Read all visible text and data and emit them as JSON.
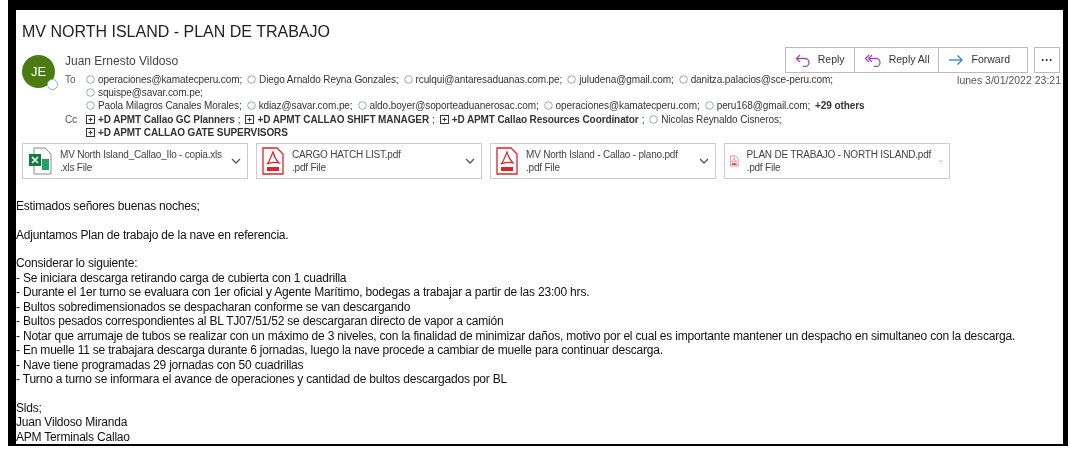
{
  "subject": "MV NORTH ISLAND - PLAN DE TRABAJO",
  "actions": [
    {
      "kind": "reply",
      "label": "Reply"
    },
    {
      "kind": "reply_all",
      "label": "Reply All"
    },
    {
      "kind": "forward",
      "label": "Forward"
    },
    {
      "kind": "more",
      "label": "···"
    }
  ],
  "sender": {
    "initials": "JE",
    "name": "Juan Ernesto Vildoso"
  },
  "date": "lunes 3/01/2022 23:21",
  "to": {
    "label": "To",
    "recipients": [
      {
        "kind": "person",
        "text": "operaciones@kamatecperu.com;"
      },
      {
        "kind": "person",
        "text": "Diego Arnaldo Reyna Gonzales;"
      },
      {
        "kind": "person",
        "text": "rculqui@antaresaduanas.com.pe;"
      },
      {
        "kind": "person",
        "text": "juludena@gmail.com;"
      },
      {
        "kind": "person",
        "text": "danitza.palacios@sce-peru.com;"
      },
      {
        "kind": "person",
        "text": "squispe@savar.com.pe;"
      },
      {
        "kind": "break"
      },
      {
        "kind": "person",
        "text": "Paola Milagros Canales Morales;"
      },
      {
        "kind": "person",
        "text": "kdiaz@savar.com.pe;"
      },
      {
        "kind": "person",
        "text": "aldo.boyer@soporteaduanerosac.com;"
      },
      {
        "kind": "person",
        "text": "operaciones@kamatecperu.com;"
      },
      {
        "kind": "person",
        "text": "peru168@gmail.com;"
      },
      {
        "kind": "more",
        "text": "+29 others"
      }
    ]
  },
  "cc": {
    "label": "Cc",
    "recipients": [
      {
        "kind": "group",
        "text": "+D APMT Callao GC Planners",
        "sep": ";"
      },
      {
        "kind": "group",
        "text": "+D APMT CALLAO SHIFT MANAGER",
        "sep": ";"
      },
      {
        "kind": "group",
        "text": "+D APMT Callao Resources Coordinator",
        "sep": ";"
      },
      {
        "kind": "person",
        "text": "Nicolas Reynaldo Cisneros;"
      },
      {
        "kind": "group",
        "text": "+D APMT CALLAO GATE SUPERVISORS"
      }
    ]
  },
  "attachments": [
    {
      "kind": "xls",
      "name": "MV North Island_Callao_Ilo - copia.xls",
      "type": ".xls File"
    },
    {
      "kind": "pdf",
      "name": "CARGO HATCH LIST.pdf",
      "type": ".pdf File"
    },
    {
      "kind": "pdf",
      "name": "MV North Island - Callao - plano.pdf",
      "type": ".pdf File"
    },
    {
      "kind": "pdf",
      "name": "PLAN DE TRABAJO - NORTH ISLAND.pdf",
      "type": ".pdf File"
    }
  ],
  "body": [
    [
      "Estimados señores buenas noches;"
    ],
    [
      "Adjuntamos Plan de trabajo de la nave en referencia."
    ],
    [
      "Considerar lo siguiente:",
      "- Se iniciara descarga retirando carga de cubierta con 1 cuadrilla",
      "- Durante el 1er turno se evaluara con 1er oficial y Agente Marítimo, bodegas a trabajar a partir de las 23:00 hrs.",
      "- Bultos sobredimensionados se despacharan conforme se van descargando",
      "- Bultos pesados correspondientes al BL TJ07/51/52 se descargaran directo de vapor a camión",
      "- Notar que arrumaje de tubos se realizar con un máximo de 3 niveles, con la finalidad de minimizar daños, motivo por el cual es importante mantener un despacho en simultaneo con la descarga.",
      "- En muelle 11 se trabajara descarga durante 6 jornadas, luego la nave procede a cambiar de muelle para continuar descarga.",
      "- Nave tiene programadas 29 jornadas con 50 cuadrillas",
      "- Turno a turno se informara el avance de operaciones y cantidad de bultos descargados por BL"
    ],
    [
      "Slds;",
      "Juan Vildoso Miranda",
      "APM Terminals Callao"
    ]
  ]
}
